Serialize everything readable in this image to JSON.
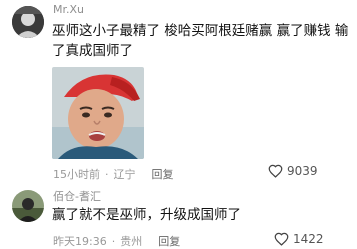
{
  "comments": [
    {
      "username": "Mr.Xu",
      "text": "巫师这小子最精了 梭哈买阿根廷赌赢 赢了赚钱 输了真成国师了",
      "time": "15小时前",
      "location": "辽宁",
      "reply_label": "回复",
      "likes": "9039"
    },
    {
      "username": "佰仓-耆汇",
      "text": "赢了就不是巫师，升级成国师了",
      "time": "昨天19:36",
      "location": "贵州",
      "reply_label": "回复",
      "likes": "1422"
    }
  ],
  "icons": {
    "like": "heart-outline-icon"
  },
  "colors": {
    "meta": "#999999",
    "username": "#8e8e8e",
    "text": "#111111"
  }
}
